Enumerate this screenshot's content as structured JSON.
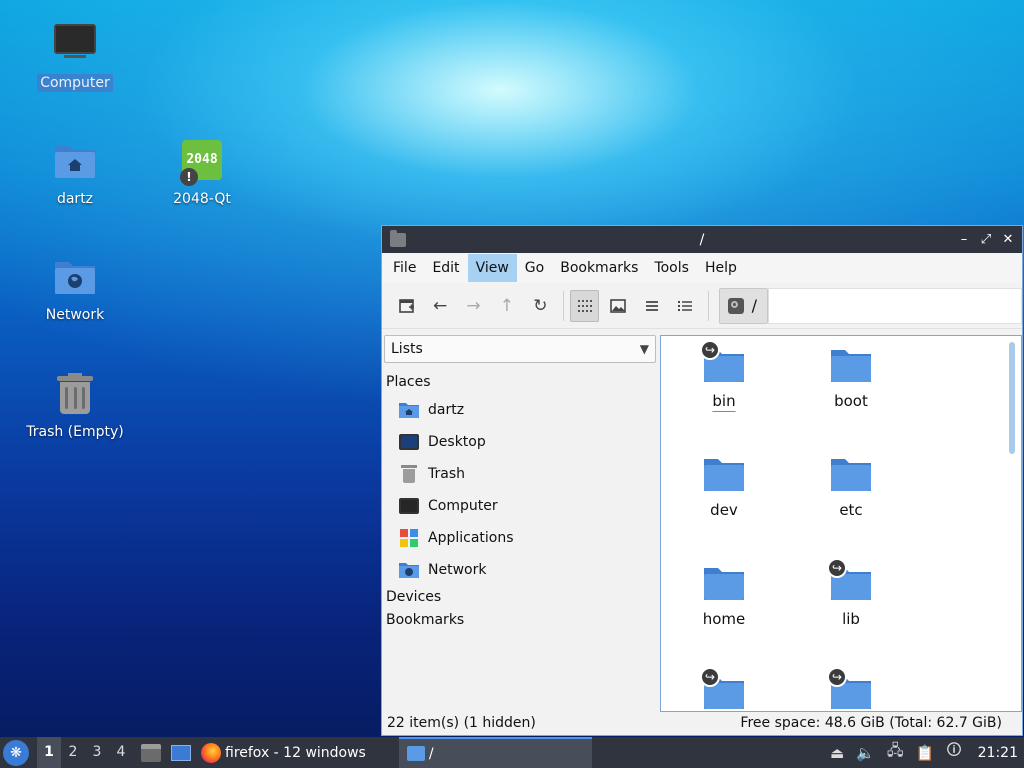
{
  "desktop": {
    "icons": [
      {
        "label": "Computer"
      },
      {
        "label": "dartz"
      },
      {
        "label": "2048-Qt",
        "badge": "2048"
      },
      {
        "label": "Network"
      },
      {
        "label": "Trash (Empty)"
      }
    ]
  },
  "window": {
    "title": "/",
    "controls": {
      "minimize": "–",
      "restore": "⤢",
      "close": "✕"
    },
    "menu": [
      "File",
      "Edit",
      "View",
      "Go",
      "Bookmarks",
      "Tools",
      "Help"
    ],
    "path_segment": "/",
    "sidebar": {
      "dropdown": "Lists",
      "places_heading": "Places",
      "places": [
        "dartz",
        "Desktop",
        "Trash",
        "Computer",
        "Applications",
        "Network"
      ],
      "devices_heading": "Devices",
      "bookmarks_heading": "Bookmarks"
    },
    "files": [
      {
        "name": "bin",
        "symlink": true
      },
      {
        "name": "boot",
        "symlink": false
      },
      {
        "name": "dev",
        "symlink": false
      },
      {
        "name": "etc",
        "symlink": false
      },
      {
        "name": "home",
        "symlink": false
      },
      {
        "name": "lib",
        "symlink": true
      },
      {
        "name": "",
        "symlink": true
      },
      {
        "name": "",
        "symlink": true
      }
    ],
    "status": {
      "items": "22 item(s) (1 hidden)",
      "free_space": "Free space: 48.6 GiB (Total: 62.7 GiB)"
    }
  },
  "taskbar": {
    "workspaces": [
      "1",
      "2",
      "3",
      "4"
    ],
    "firefox_label": "firefox - 12 windows",
    "task_label": "/",
    "clock": "21:21"
  },
  "colors": {
    "folder_blue": "#5b9be6",
    "titlebar": "#2f343f",
    "selection": "#a7d1f2"
  }
}
